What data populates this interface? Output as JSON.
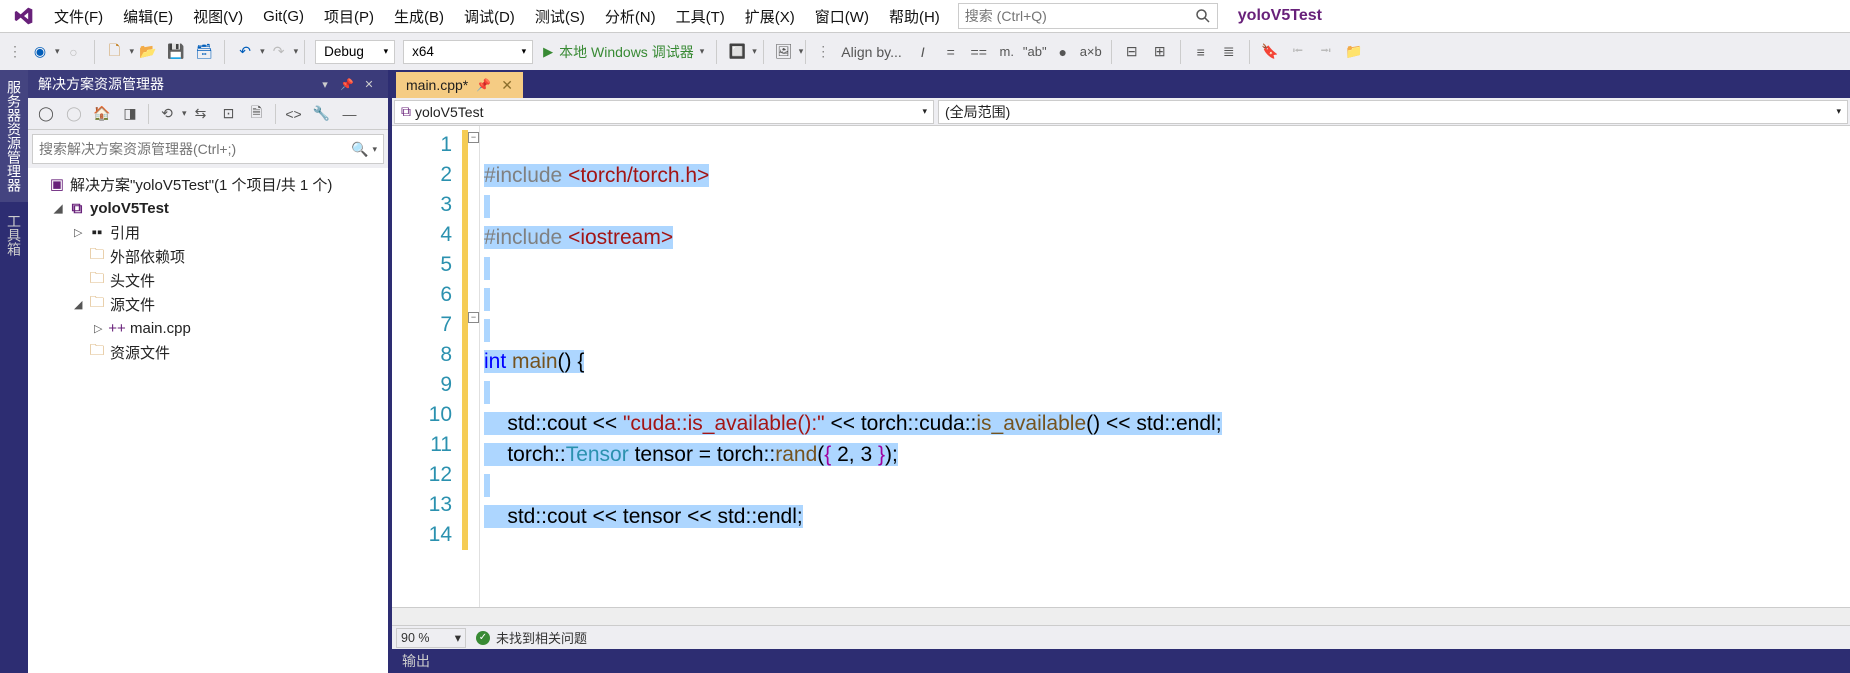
{
  "menu": {
    "file": "文件(F)",
    "edit": "编辑(E)",
    "view": "视图(V)",
    "git": "Git(G)",
    "project": "项目(P)",
    "build": "生成(B)",
    "debug": "调试(D)",
    "test": "测试(S)",
    "analyze": "分析(N)",
    "tools": "工具(T)",
    "extensions": "扩展(X)",
    "window": "窗口(W)",
    "help": "帮助(H)"
  },
  "search_placeholder": "搜索 (Ctrl+Q)",
  "project_name": "yoloV5Test",
  "toolbar": {
    "config": "Debug",
    "platform": "x64",
    "run": "本地 Windows 调试器",
    "align": "Align by..."
  },
  "sidetabs": {
    "server": "服务器资源管理器",
    "toolbox": "工具箱"
  },
  "solution": {
    "panel_title": "解决方案资源管理器",
    "search_placeholder": "搜索解决方案资源管理器(Ctrl+;)",
    "root": "解决方案\"yoloV5Test\"(1 个项目/共 1 个)",
    "project": "yoloV5Test",
    "refs": "引用",
    "external": "外部依赖项",
    "headers": "头文件",
    "sources": "源文件",
    "main": "main.cpp",
    "resources": "资源文件"
  },
  "tab": {
    "name": "main.cpp*"
  },
  "navbar": {
    "left": "yoloV5Test",
    "right": "(全局范围)"
  },
  "zoom": "90 %",
  "issues": "未找到相关问题",
  "output_title": "输出",
  "code": {
    "l1": {
      "pp": "#include ",
      "inc": "<torch/torch.h>"
    },
    "l3": {
      "pp": "#include ",
      "inc": "<iostream>"
    },
    "l7": {
      "kw": "int ",
      "fn": "main",
      "rest": "() {"
    },
    "l9": {
      "a": "    std::cout ",
      "b": "<< ",
      "str": "\"cuda::is_available():\"",
      "c": " << torch::cuda::",
      "fn": "is_available",
      "d": "() << std::endl;"
    },
    "l10": {
      "a": "    torch::",
      "ty": "Tensor",
      "b": " tensor = torch::",
      "fn": "rand",
      "c": "(",
      "br1": "{",
      "d": " 2, 3 ",
      "br2": "}",
      "e": ");"
    },
    "l12": {
      "a": "    std::cout << tensor << std::endl;"
    }
  },
  "line_numbers": [
    "1",
    "2",
    "3",
    "4",
    "5",
    "6",
    "7",
    "8",
    "9",
    "10",
    "11",
    "12",
    "13",
    "14"
  ]
}
